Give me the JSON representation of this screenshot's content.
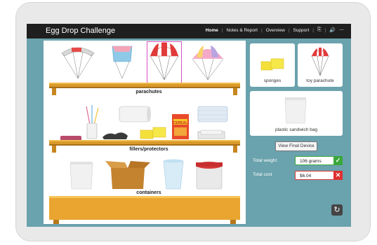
{
  "app": {
    "title": "Egg Drop Challenge"
  },
  "nav": {
    "items": [
      "Home",
      "Notes & Report",
      "Overview",
      "Support"
    ],
    "icons": [
      "share-icon",
      "volume-icon",
      "more-icon"
    ]
  },
  "shelves": {
    "parachutes_label": "parachutes",
    "fillers_label": "fillers/protectors",
    "containers_label": "containers"
  },
  "selected": {
    "cards": [
      {
        "label": "sponges"
      },
      {
        "label": "toy parachute"
      },
      {
        "label": "plastic sandwich bag"
      }
    ],
    "view_button": "View Final Device",
    "weight": {
      "label": "Total weight",
      "value": "106 grams"
    },
    "cost": {
      "label": "Total cost",
      "value": "$6.04"
    }
  },
  "colors": {
    "accent_ok": "#3aa83a",
    "accent_bad": "#e03030",
    "selection": "#d84fc2"
  }
}
